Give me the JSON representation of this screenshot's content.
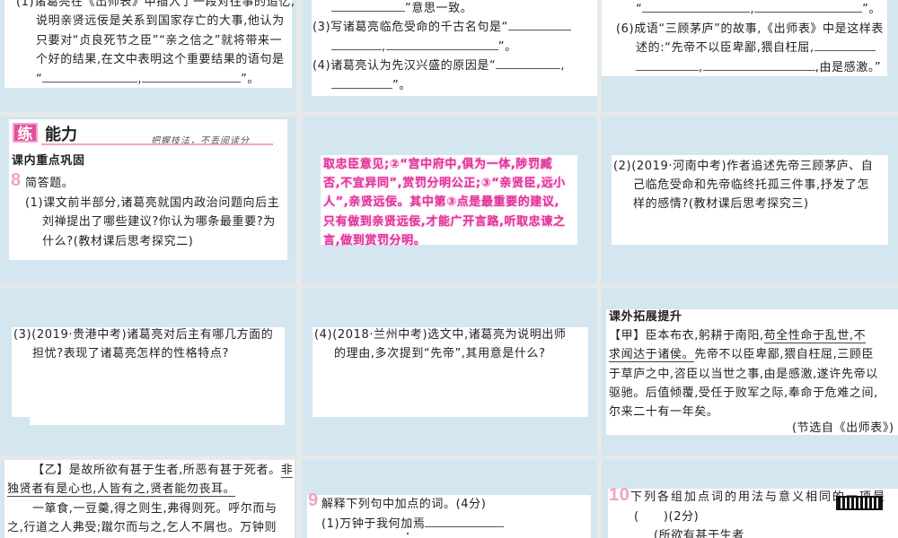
{
  "p1": {
    "l0": "(1)诸葛亮在《出师表》中插入了一段对往事的追忆,",
    "l1": "说明亲贤远佞是关系到国家存亡的大事,他认为",
    "l2": "只要对“贞良死节之臣”“亲之信之”就将带来一",
    "l3": "个好的结果,在文中表明这个重要结果的语句是",
    "l4a": "“",
    "l4b": ",",
    "l4c": "”。"
  },
  "p2": {
    "l0": "”意思一致。",
    "l1": "(3)写诸葛亮临危受命的千古名句是“",
    "l2a": ",",
    "l2b": "”。",
    "l3": "(4)诸葛亮认为先汉兴盛的原因是“",
    "l3b": ",",
    "l4": "”。"
  },
  "p3": {
    "l0a": "“",
    "l0b": ",",
    "l0c": "”。",
    "l1": "(6)成语“三顾茅庐”的故事,《出师表》中是这样表",
    "l2": "述的:“先帝不以臣卑鄙,猥自枉屈,",
    "l3a": ",",
    "l3b": ",由是感激。”"
  },
  "p4": {
    "badge": "练",
    "title": "能力",
    "tagline": "把握技法，不丢阅读分",
    "section": "课内重点巩固",
    "num": "8",
    "q": "简答题。",
    "l1": "(1)课文前半部分,诸葛亮就国内政治问题向后主",
    "l2": "刘禅提出了哪些建议?你认为哪条最重要?为",
    "l3": "什么?(教材课后思考探究二)"
  },
  "p5": {
    "lines": [
      "取忠臣意见;②“宫中府中,俱为一体,陟罚臧",
      "否,不宜异同”,赏罚分明公正;③“亲贤臣,远小",
      "人”,亲贤远佞。其中第③点是最重要的建议,",
      "只有做到亲贤远佞,才能广开言路,听取忠谏之",
      "言,做到赏罚分明。"
    ]
  },
  "p6": {
    "lines": [
      "(2)(2019·河南中考)作者追述先帝三顾茅庐、自",
      "己临危受命和先帝临终托孤三件事,抒发了怎",
      "样的感情?(教材课后思考探究三)"
    ]
  },
  "p7": {
    "lines": [
      "(3)(2019·贵港中考)诸葛亮对后主有哪几方面的",
      "担忧?表现了诸葛亮怎样的性格特点?"
    ]
  },
  "p8": {
    "lines": [
      "(4)(2018·兰州中考)选文中,诸葛亮为说明出师",
      "的理由,多次提到“先帝”,其用意是什么?"
    ]
  },
  "p9": {
    "section": "课外拓展提升",
    "l1a": "【甲】臣本布衣,躬耕于南阳,",
    "l1b": "苟全性命于乱世,不",
    "l2a": "求闻达于诸侯。",
    "l2b": "先帝不以臣卑鄙,猥自枉屈,三顾臣",
    "l3": "于草庐之中,咨臣以当世之事,由是感激,遂许先帝以",
    "l4": "驱驰。后值倾覆,受任于败军之际,奉命于危难之间,",
    "l5": "尔来二十有一年矣。",
    "source": "(节选自《出师表》)"
  },
  "p10": {
    "l1a": "【乙】是故所欲有甚于生者,所恶有甚于死者。",
    "l1b": "非",
    "l2": "独贤者有是心也,人皆有之,贤者能勿丧耳。",
    "l3": "一箪食,一豆羹,得之则生,弗得则死。呼尔而与",
    "l4": "之,行道之人弗受;蹴尔而与之,乞人不屑也。万钟则"
  },
  "p11": {
    "num": "9",
    "q": "解释下列句中加点的词。(4分)",
    "l1a": "(1)万钟于我何",
    "l1b": "加",
    "l1c": "焉"
  },
  "p12": {
    "num": "10",
    "q": "下列各组加点词的用法与意义相同的一项是",
    "l2": "(　　)(2分)",
    "l3": "(所欲有甚于生者"
  }
}
